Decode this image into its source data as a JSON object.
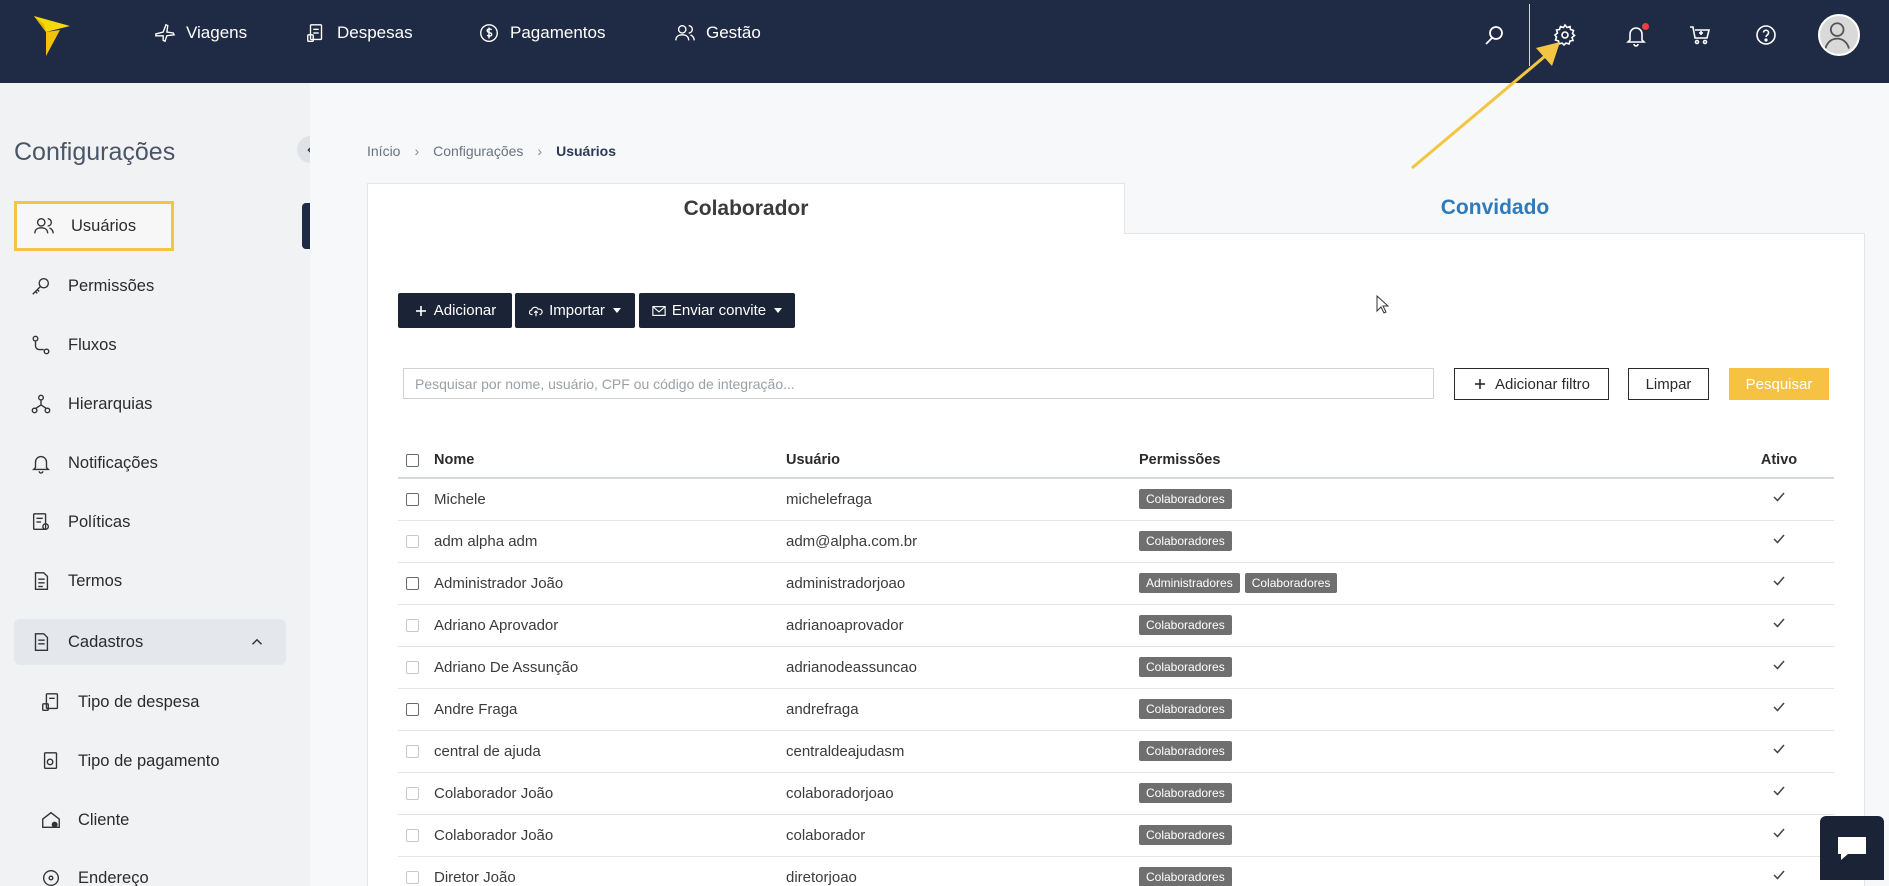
{
  "nav": {
    "items": [
      {
        "label": "Viagens",
        "icon": "plane-icon"
      },
      {
        "label": "Despesas",
        "icon": "receipt-icon"
      },
      {
        "label": "Pagamentos",
        "icon": "dollar-icon"
      },
      {
        "label": "Gestão",
        "icon": "users-icon"
      }
    ]
  },
  "sidebar": {
    "title": "Configurações",
    "items": [
      {
        "label": "Usuários"
      },
      {
        "label": "Permissões"
      },
      {
        "label": "Fluxos"
      },
      {
        "label": "Hierarquias"
      },
      {
        "label": "Notificações"
      },
      {
        "label": "Políticas"
      },
      {
        "label": "Termos"
      },
      {
        "label": "Cadastros"
      }
    ],
    "subitems": [
      {
        "label": "Tipo de despesa"
      },
      {
        "label": "Tipo de pagamento"
      },
      {
        "label": "Cliente"
      },
      {
        "label": "Endereço"
      }
    ]
  },
  "breadcrumb": {
    "home": "Início",
    "section": "Configurações",
    "current": "Usuários"
  },
  "tabs": {
    "colaborador": "Colaborador",
    "convidado": "Convidado"
  },
  "toolbar": {
    "add": "Adicionar",
    "import": "Importar",
    "invite": "Enviar convite"
  },
  "filters": {
    "search_placeholder": "Pesquisar por nome, usuário, CPF ou código de integração...",
    "add_filter": "Adicionar filtro",
    "clear": "Limpar",
    "search": "Pesquisar"
  },
  "table": {
    "headers": {
      "name": "Nome",
      "user": "Usuário",
      "permissions": "Permissões",
      "active": "Ativo"
    },
    "rows": [
      {
        "name": "Michele",
        "user": "michelefraga",
        "perms": [
          "Colaboradores"
        ]
      },
      {
        "name": "adm alpha adm",
        "user": "adm@alpha.com.br",
        "perms": [
          "Colaboradores"
        ]
      },
      {
        "name": "Administrador João",
        "user": "administradorjoao",
        "perms": [
          "Administradores",
          "Colaboradores"
        ]
      },
      {
        "name": "Adriano Aprovador",
        "user": "adrianoaprovador",
        "perms": [
          "Colaboradores"
        ]
      },
      {
        "name": "Adriano De Assunção",
        "user": "adrianodeassuncao",
        "perms": [
          "Colaboradores"
        ]
      },
      {
        "name": "Andre Fraga",
        "user": "andrefraga",
        "perms": [
          "Colaboradores"
        ]
      },
      {
        "name": "central de ajuda",
        "user": "centraldeajudasm",
        "perms": [
          "Colaboradores"
        ]
      },
      {
        "name": "Colaborador João",
        "user": "colaboradorjoao",
        "perms": [
          "Colaboradores"
        ]
      },
      {
        "name": "Colaborador João",
        "user": "colaborador",
        "perms": [
          "Colaboradores"
        ]
      },
      {
        "name": "Diretor João",
        "user": "diretorjoao",
        "perms": [
          "Colaboradores"
        ]
      }
    ]
  },
  "colors": {
    "topbar": "#1f2a44",
    "accent_yellow": "#f5c244",
    "link_blue": "#2f7ab8"
  }
}
